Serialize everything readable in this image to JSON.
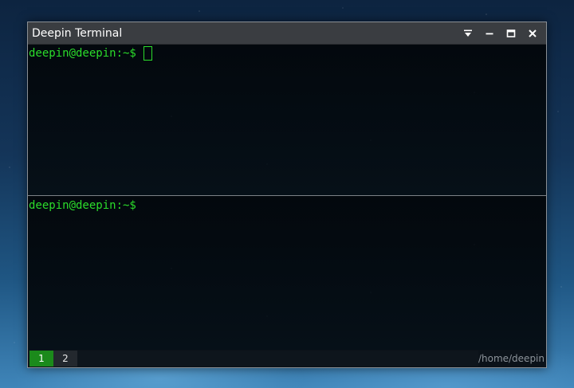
{
  "window": {
    "title": "Deepin Terminal",
    "controls": [
      {
        "icon": "dropdown-menu-icon"
      },
      {
        "icon": "minimize-icon"
      },
      {
        "icon": "maximize-icon"
      },
      {
        "icon": "close-icon"
      }
    ]
  },
  "panes": [
    {
      "prompt": "deepin@deepin:~$",
      "has_cursor": true
    },
    {
      "prompt": "deepin@deepin:~$",
      "has_cursor": false
    }
  ],
  "tabs": [
    {
      "label": "1",
      "active": true
    },
    {
      "label": "2",
      "active": false
    }
  ],
  "status": {
    "cwd": "/home/deepin"
  },
  "colors": {
    "prompt": "#2bdc2b",
    "active_tab": "#1b8a1b",
    "titlebar": "#3a3d41",
    "terminal_bg": "#03080d"
  }
}
